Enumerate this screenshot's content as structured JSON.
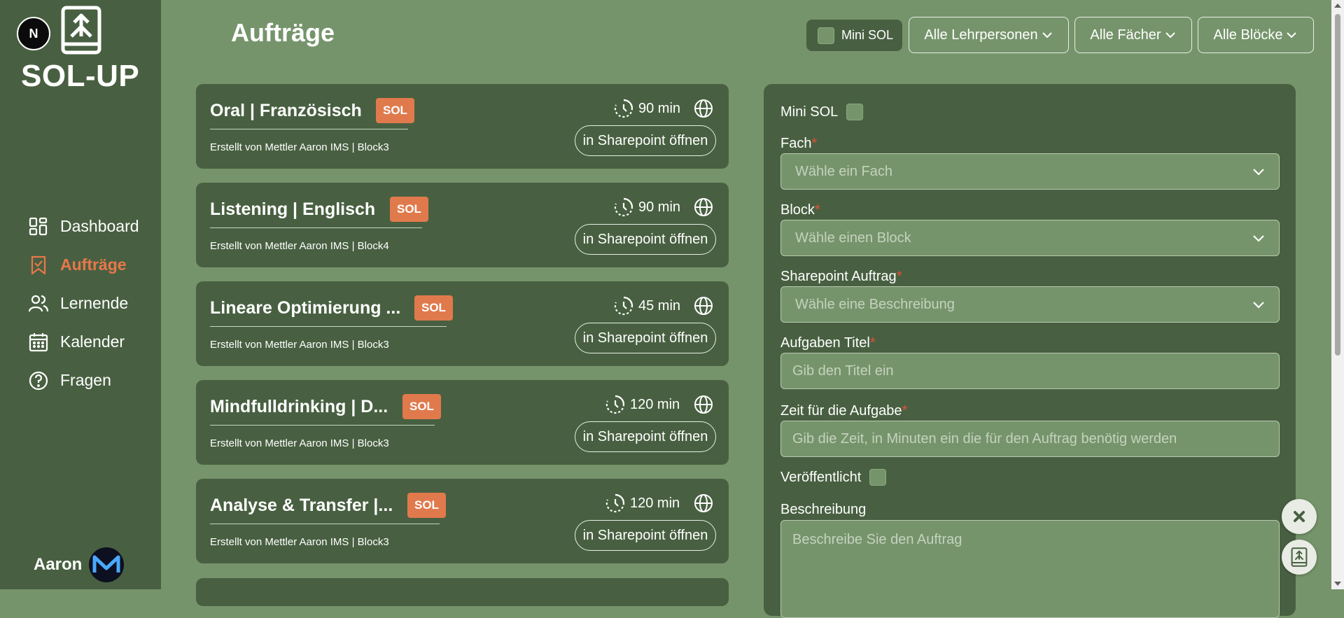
{
  "app": {
    "next_badge": "N",
    "brand": "SOL-UP"
  },
  "nav": [
    {
      "label": "Dashboard",
      "icon": "dashboard-icon",
      "active": false
    },
    {
      "label": "Aufträge",
      "icon": "bookmark-check-icon",
      "active": true
    },
    {
      "label": "Lernende",
      "icon": "users-icon",
      "active": false
    },
    {
      "label": "Kalender",
      "icon": "calendar-icon",
      "active": false
    },
    {
      "label": "Fragen",
      "icon": "help-circle-icon",
      "active": false
    }
  ],
  "user": {
    "name": "Aaron",
    "avatar_text": "Meta"
  },
  "header": {
    "title": "Aufträge",
    "mini_sol_label": "Mini SOL",
    "filters": {
      "teachers": "Alle Lehrpersonen",
      "subjects": "Alle Fächer",
      "blocks": "Alle Blöcke"
    }
  },
  "cards": [
    {
      "title": "Oral | Französisch",
      "badge": "SOL",
      "time": "90 min",
      "author": "Erstellt von Mettler Aaron IMS | Block3",
      "button": "in Sharepoint öffnen"
    },
    {
      "title": "Listening | Englisch",
      "badge": "SOL",
      "time": "90 min",
      "author": "Erstellt von Mettler Aaron IMS | Block4",
      "button": "in Sharepoint öffnen"
    },
    {
      "title": "Lineare Optimierung ...",
      "badge": "SOL",
      "time": "45 min",
      "author": "Erstellt von Mettler Aaron IMS | Block3",
      "button": "in Sharepoint öffnen"
    },
    {
      "title": "Mindfulldrinking | D...",
      "badge": "SOL",
      "time": "120 min",
      "author": "Erstellt von Mettler Aaron IMS | Block3",
      "button": "in Sharepoint öffnen"
    },
    {
      "title": "Analyse & Transfer |...",
      "badge": "SOL",
      "time": "120 min",
      "author": "Erstellt von Mettler Aaron IMS | Block3",
      "button": "in Sharepoint öffnen"
    }
  ],
  "form": {
    "mini_sol_label": "Mini SOL",
    "subject_label": "Fach",
    "subject_placeholder": "Wähle ein Fach",
    "block_label": "Block",
    "block_placeholder": "Wähle einen Block",
    "sharepoint_label": "Sharepoint Auftrag",
    "sharepoint_placeholder": "Wähle eine Beschreibung",
    "title_label": "Aufgaben Titel",
    "title_placeholder": "Gib den Titel ein",
    "time_label": "Zeit für die Aufgabe",
    "time_placeholder": "Gib die Zeit, in Minuten ein die für den Auftrag benötig werden",
    "published_label": "Veröffentlicht",
    "description_label": "Beschreibung",
    "description_placeholder": "Beschreibe Sie den Auftrag",
    "required_mark": "*"
  },
  "colors": {
    "background": "#76946b",
    "panel": "#486041",
    "accent": "#e07a4c",
    "required": "#e0513a"
  }
}
